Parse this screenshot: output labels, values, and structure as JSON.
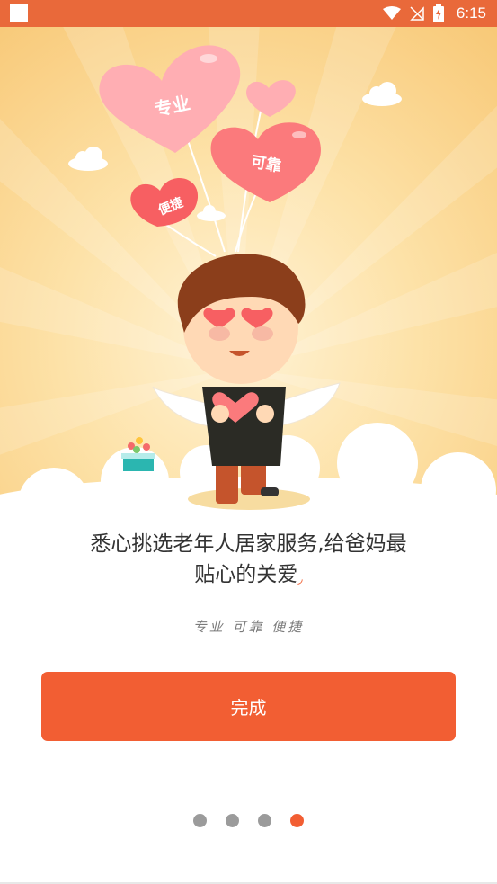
{
  "status_bar": {
    "time": "6:15",
    "color": "#e9693a"
  },
  "hero": {
    "balloons": {
      "big": "专业",
      "right": "可靠",
      "left": "便捷"
    }
  },
  "headline": {
    "line1": "悉心挑选老年人居家服务,给爸妈最",
    "line2": "贴心的关爱"
  },
  "tagline": "专业  可靠  便捷",
  "finish_button": {
    "label": "完成",
    "color": "#f25e33"
  },
  "pager": {
    "total": 4,
    "active_index": 3
  }
}
